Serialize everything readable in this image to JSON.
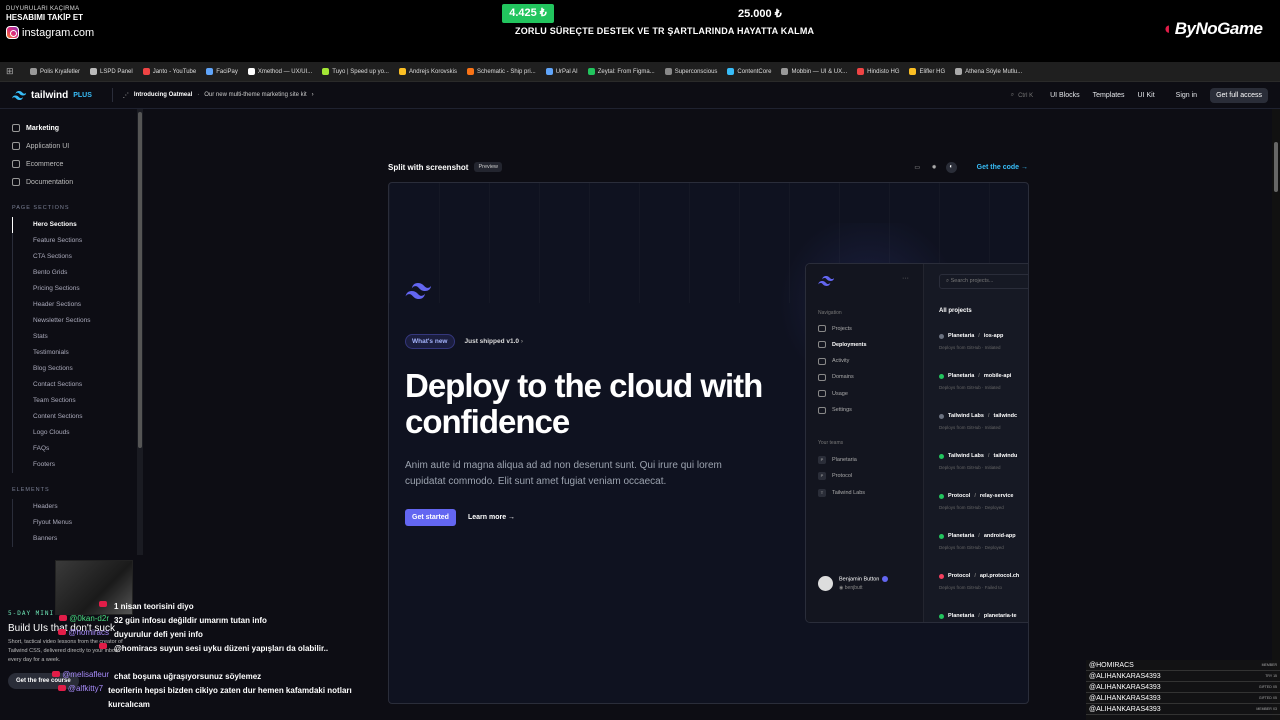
{
  "stream": {
    "ig_line1": "DUYURULARI KAÇIRMA",
    "ig_line2": "HESABIMI TAKİP ET",
    "ig_handle": "instagram.com",
    "money_current": "4.425 ₺",
    "money_target": "25.000 ₺",
    "message": "ZORLU SÜREÇTE DESTEK VE TR ŞARTLARINDA HAYATTA KALMA",
    "brand": "ByNoGame"
  },
  "bookmarks": [
    "Polis Kıyafetler",
    "LSPD Panel",
    "Janto - YouTube",
    "FaciPay",
    "Xmethod — UX/UI...",
    "Tuyo | Speed up yo...",
    "Andrejs Korovskis",
    "Schematic - Ship pri...",
    "UrPal AI",
    "Zeytal: From Figma...",
    "Superconscious",
    "ContentCore",
    "Mobbin — UI & UX...",
    "Hindisto HG",
    "Elifler HG",
    "Athena Söyle Mutlu..."
  ],
  "header": {
    "logo": "tailwind",
    "logo_plus": "PLUS",
    "announce_bold": "Introducing Oatmeal",
    "announce_text": "Our new multi-theme marketing site kit",
    "search_hint": "Ctrl K",
    "nav": [
      "UI Blocks",
      "Templates",
      "UI Kit",
      "Sign in"
    ],
    "cta": "Get full access"
  },
  "sidebar": {
    "top": [
      "Marketing",
      "Application UI",
      "Ecommerce",
      "Documentation"
    ],
    "section1": "PAGE SECTIONS",
    "sections": [
      "Hero Sections",
      "Feature Sections",
      "CTA Sections",
      "Bento Grids",
      "Pricing Sections",
      "Header Sections",
      "Newsletter Sections",
      "Stats",
      "Testimonials",
      "Blog Sections",
      "Contact Sections",
      "Team Sections",
      "Content Sections",
      "Logo Clouds",
      "FAQs",
      "Footers"
    ],
    "section2": "ELEMENTS",
    "elements": [
      "Headers",
      "Flyout Menus",
      "Banners"
    ]
  },
  "preview": {
    "title": "Split with screenshot",
    "badge": "Preview",
    "get_code": "Get the code →"
  },
  "hero": {
    "pill_new": "What's new",
    "pill_ship": "Just shipped v1.0",
    "title": "Deploy to the cloud with confidence",
    "desc": "Anim aute id magna aliqua ad ad non deserunt sunt. Qui irure qui lorem cupidatat commodo. Elit sunt amet fugiat veniam occaecat.",
    "cta_primary": "Get started",
    "cta_secondary": "Learn more →"
  },
  "app": {
    "nav_head": "Navigation",
    "nav": [
      "Projects",
      "Deployments",
      "Activity",
      "Domains",
      "Usage",
      "Settings"
    ],
    "teams_head": "Your teams",
    "teams": [
      {
        "initial": "P",
        "name": "Planetaria"
      },
      {
        "initial": "P",
        "name": "Protocol"
      },
      {
        "initial": "T",
        "name": "Tailwind Labs"
      }
    ],
    "user_name": "Benjamin Button",
    "user_handle": "benjbutt",
    "search": "Search projects...",
    "all_projects": "All projects",
    "projects": [
      {
        "org": "Planetaria",
        "repo": "ios-app",
        "status": "gray",
        "meta": "Deploys from GitHub · Initiated"
      },
      {
        "org": "Planetaria",
        "repo": "mobile-api",
        "status": "green",
        "meta": "Deploys from GitHub · Initiated"
      },
      {
        "org": "Tailwind Labs",
        "repo": "tailwindc",
        "status": "gray",
        "meta": "Deploys from GitHub · Initiated"
      },
      {
        "org": "Tailwind Labs",
        "repo": "tailwindu",
        "status": "green",
        "meta": "Deploys from GitHub · Initiated"
      },
      {
        "org": "Protocol",
        "repo": "relay-service",
        "status": "green",
        "meta": "Deploys from GitHub · Deployed"
      },
      {
        "org": "Planetaria",
        "repo": "android-app",
        "status": "green",
        "meta": "Deploys from GitHub · Deployed"
      },
      {
        "org": "Protocol",
        "repo": "api.protocol.ch",
        "status": "red",
        "meta": "Deploys from GitHub · Failed to"
      },
      {
        "org": "Planetaria",
        "repo": "planetaria-te",
        "status": "green",
        "meta": ""
      }
    ]
  },
  "promo": {
    "heading": "5-DAY MINI-COURSE",
    "title": "Build UIs that don't suck",
    "desc": "Short, tactical video lessons from the creator of Tailwind CSS, delivered directly to your inbox every day for a week.",
    "button": "Get the free course"
  },
  "chat": [
    {
      "user": "",
      "msg": "1 nisan teorisini diyo"
    },
    {
      "user": "@0kan-d2r",
      "msg": "32 gün infosu değildir umarım tutan info"
    },
    {
      "user": "@homiracs",
      "msg": "duyurulur defi yeni info"
    },
    {
      "user": "",
      "msg": "@homiracs suyun sesi uyku düzeni yapışları da olabilir.."
    },
    {
      "user": "@melisafleur",
      "msg": "chat boşuna uğraşıyorsunuz söylemez"
    },
    {
      "user": "@alfkitty7",
      "msg": "teorilerin hepsi bizden cikiyo zaten dur hemen kafamdaki notları kurcalıcam"
    }
  ],
  "members": [
    {
      "name": "@HOMIRACS",
      "tag": "MEMBER"
    },
    {
      "name": "@ALIHANKARAS4393",
      "tag": "TRY 15"
    },
    {
      "name": "@ALIHANKARAS4393",
      "tag": "GIFTED X5"
    },
    {
      "name": "@ALIHANKARAS4393",
      "tag": "GIFTED X5"
    },
    {
      "name": "@ALIHANKARAS4393",
      "tag": "MEMBER X3"
    }
  ]
}
